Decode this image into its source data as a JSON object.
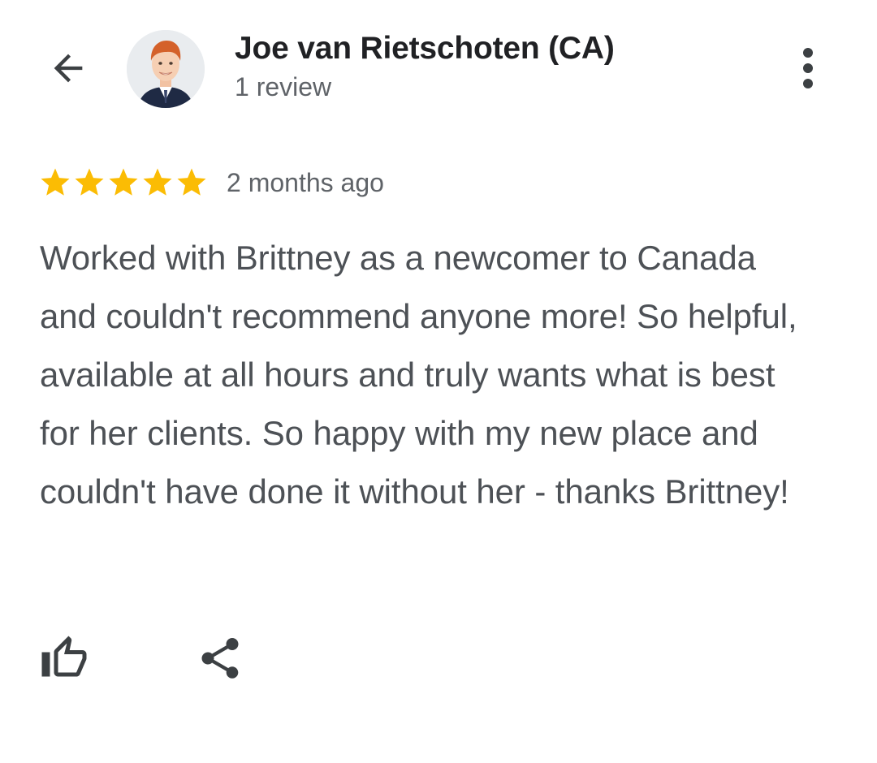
{
  "header": {
    "user_name": "Joe van Rietschoten (CA)",
    "review_count": "1 review",
    "back_icon": "arrow-left-icon",
    "more_icon": "more-vert-icon"
  },
  "review": {
    "rating": 5,
    "max_rating": 5,
    "time_ago": "2 months ago",
    "text": "Worked with Brittney as a newcomer to Canada and couldn't recommend anyone more! So helpful, available at all hours and truly wants what is best for her clients. So happy with my new place and couldn't have done it without her - thanks Brittney!"
  },
  "actions": {
    "like_icon": "thumb-up-icon",
    "share_icon": "share-icon"
  },
  "colors": {
    "star": "#fbbc04",
    "title": "#202124",
    "secondary": "#5f6368",
    "body": "#4d5156",
    "icon": "#3c4043"
  }
}
